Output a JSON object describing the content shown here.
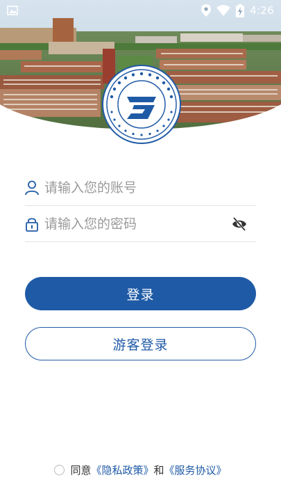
{
  "status_bar": {
    "time": "4:26",
    "icons": [
      "image-notification-icon",
      "location-icon",
      "wifi-icon",
      "battery-charging-icon"
    ]
  },
  "logo": {
    "name": "ningxia-college-of-construction-logo",
    "lettering_cn": "宁夏建设职业技术学院",
    "lettering_en": "NINGXIA COLLEGE OF CONSTRUCTION"
  },
  "form": {
    "account_placeholder": "请输入您的账号",
    "account_value": "",
    "password_placeholder": "请输入您的密码",
    "password_value": "",
    "account_icon": "user-icon",
    "password_icon": "lock-icon",
    "visibility_icon": "eye-off-icon"
  },
  "buttons": {
    "login": "登录",
    "guest_login": "游客登录"
  },
  "agreement": {
    "prefix": "同意",
    "privacy_link": "《隐私政策》",
    "and": "和",
    "service_link": "《服务协议》"
  },
  "colors": {
    "primary": "#1f5aa6",
    "text_muted": "#9a9a9a",
    "divider": "#e3e3e3"
  }
}
